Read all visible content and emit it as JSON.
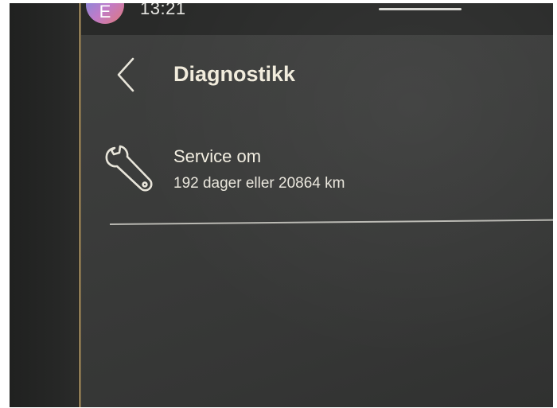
{
  "status_bar": {
    "avatar_initial": "E",
    "time": "13:21"
  },
  "header": {
    "back_icon": "chevron-left-icon",
    "title": "Diagnostikk"
  },
  "service": {
    "icon": "wrench-icon",
    "title": "Service om",
    "detail": "192 dager eller 20864 km"
  },
  "colors": {
    "screen_background": "#3a3b3a",
    "text_primary": "#f1ecdc",
    "divider": "#b9b8b2"
  }
}
